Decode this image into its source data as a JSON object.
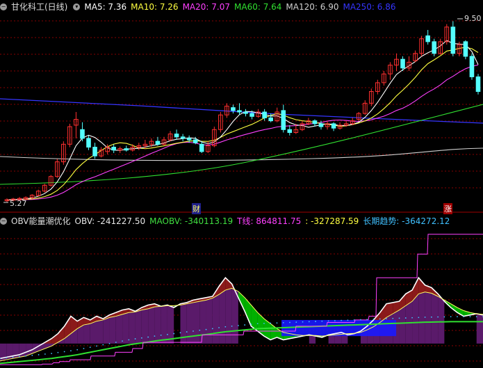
{
  "colors": {
    "bull": "#ff3030",
    "bear": "#54ffff",
    "ma5": "#ffffff",
    "ma10": "#ffff40",
    "ma20": "#ff40ff",
    "ma60": "#30e030",
    "ma120": "#d0d0d0",
    "ma250": "#3535ff",
    "grid": "#8a0000"
  },
  "header": {
    "icon": "circle-minus-icon",
    "title": "甘化科工(日线)",
    "ma": [
      {
        "label": "MA5: 7.36",
        "color": "#ffffff"
      },
      {
        "label": "MA10: 7.26",
        "color": "#ffff40"
      },
      {
        "label": "MA20: 7.07",
        "color": "#ff40ff"
      },
      {
        "label": "MA60: 7.64",
        "color": "#30e030"
      },
      {
        "label": "MA120: 6.90",
        "color": "#d0d0d0"
      },
      {
        "label": "MA250: 6.86",
        "color": "#3535ff"
      }
    ]
  },
  "price": {
    "high_label": "9.50",
    "low_label": "5.27",
    "marker_cai": "财",
    "marker_zhang": "涨",
    "candles": [
      [
        5.27,
        5.31,
        5.23,
        5.35
      ],
      [
        5.29,
        5.33,
        5.25,
        5.37
      ],
      [
        5.31,
        5.35,
        5.28,
        5.4
      ],
      [
        5.33,
        5.38,
        5.3,
        5.42
      ],
      [
        5.38,
        5.46,
        5.33,
        5.5
      ],
      [
        5.45,
        5.6,
        5.42,
        5.65
      ],
      [
        5.6,
        5.8,
        5.55,
        5.85
      ],
      [
        5.8,
        6.1,
        5.75,
        6.15
      ],
      [
        6.1,
        6.6,
        6.05,
        6.7
      ],
      [
        6.6,
        7.2,
        6.5,
        7.3
      ],
      [
        7.2,
        7.8,
        7.1,
        7.9
      ],
      [
        7.85,
        8.05,
        7.4,
        8.3
      ],
      [
        7.7,
        7.4,
        7.3,
        7.95
      ],
      [
        7.4,
        7.1,
        7.0,
        7.5
      ],
      [
        7.1,
        6.8,
        6.7,
        7.25
      ],
      [
        6.8,
        7.0,
        6.75,
        7.1
      ],
      [
        6.95,
        7.1,
        6.85,
        7.2
      ],
      [
        7.1,
        7.0,
        6.9,
        7.2
      ],
      [
        7.0,
        7.05,
        6.9,
        7.12
      ],
      [
        7.05,
        7.0,
        6.95,
        7.15
      ],
      [
        7.0,
        7.1,
        6.95,
        7.2
      ],
      [
        7.1,
        7.15,
        7.0,
        7.25
      ],
      [
        7.15,
        7.2,
        7.05,
        7.35
      ],
      [
        7.2,
        7.3,
        7.1,
        7.4
      ],
      [
        7.3,
        7.2,
        7.15,
        7.45
      ],
      [
        7.2,
        7.35,
        7.15,
        7.45
      ],
      [
        7.35,
        7.55,
        7.3,
        7.65
      ],
      [
        7.55,
        7.45,
        7.35,
        7.7
      ],
      [
        7.45,
        7.4,
        7.3,
        7.55
      ],
      [
        7.4,
        7.35,
        7.25,
        7.5
      ],
      [
        7.35,
        7.25,
        7.2,
        7.45
      ],
      [
        7.2,
        6.95,
        6.9,
        7.3
      ],
      [
        6.95,
        7.15,
        6.9,
        7.3
      ],
      [
        7.15,
        7.7,
        7.1,
        7.8
      ],
      [
        7.7,
        8.2,
        7.6,
        8.3
      ],
      [
        8.2,
        8.5,
        8.1,
        8.6
      ],
      [
        8.45,
        8.35,
        8.25,
        8.55
      ],
      [
        8.35,
        8.3,
        8.2,
        8.6
      ],
      [
        8.3,
        8.25,
        8.15,
        8.4
      ],
      [
        8.25,
        8.15,
        8.05,
        8.35
      ],
      [
        8.15,
        8.3,
        8.1,
        8.4
      ],
      [
        8.3,
        8.1,
        8.0,
        8.4
      ],
      [
        8.1,
        8.0,
        7.95,
        8.25
      ],
      [
        8.0,
        8.3,
        7.95,
        8.45
      ],
      [
        8.35,
        7.7,
        7.6,
        8.55
      ],
      [
        7.7,
        7.6,
        7.5,
        7.85
      ],
      [
        7.6,
        7.7,
        7.55,
        7.9
      ],
      [
        7.7,
        7.9,
        7.65,
        8.0
      ],
      [
        7.9,
        8.0,
        7.85,
        8.1
      ],
      [
        8.0,
        7.9,
        7.8,
        8.05
      ],
      [
        7.9,
        7.8,
        7.7,
        8.0
      ],
      [
        7.8,
        7.9,
        7.7,
        8.0
      ],
      [
        7.9,
        7.75,
        7.65,
        7.95
      ],
      [
        7.75,
        7.85,
        7.7,
        7.95
      ],
      [
        7.85,
        7.9,
        7.8,
        8.0
      ],
      [
        7.9,
        8.0,
        7.85,
        8.1
      ],
      [
        8.05,
        8.25,
        8.0,
        8.3
      ],
      [
        8.25,
        8.6,
        8.2,
        8.7
      ],
      [
        8.6,
        9.0,
        8.5,
        9.1
      ],
      [
        9.0,
        9.3,
        8.9,
        9.4
      ],
      [
        9.3,
        9.6,
        9.2,
        9.7
      ],
      [
        9.6,
        9.9,
        9.4,
        10.0
      ],
      [
        9.9,
        10.1,
        9.7,
        10.3
      ],
      [
        10.1,
        9.8,
        9.7,
        10.2
      ],
      [
        9.8,
        10.0,
        9.7,
        10.2
      ],
      [
        10.05,
        10.3,
        10.0,
        10.4
      ],
      [
        10.3,
        10.8,
        10.2,
        10.9
      ],
      [
        10.9,
        10.7,
        10.6,
        11.1
      ],
      [
        10.7,
        10.3,
        10.2,
        10.8
      ],
      [
        10.3,
        10.7,
        10.25,
        10.8
      ],
      [
        10.7,
        11.2,
        10.6,
        11.3
      ],
      [
        11.2,
        10.3,
        10.2,
        11.4
      ],
      [
        10.3,
        10.6,
        10.2,
        10.7
      ],
      [
        10.7,
        10.2,
        10.1,
        10.75
      ],
      [
        10.2,
        9.5,
        9.4,
        10.3
      ],
      [
        9.5,
        9.0,
        8.9,
        9.6
      ]
    ]
  },
  "indicator": {
    "icon": "circle-minus-icon",
    "name": "OBV能量潮优化",
    "items": [
      {
        "label": "OBV: -241227.50",
        "color": "#e8e8e8"
      },
      {
        "label": "MAOBV: -340113.19",
        "color": "#40e040"
      },
      {
        "label": "T线: 864811.75",
        "color": "#ff40ff"
      },
      {
        "label": ": -327287.59",
        "color": "#ffff40"
      },
      {
        "label": "长期趋势: -364272.12",
        "color": "#40c0ff"
      }
    ],
    "obv": [
      -640,
      -630,
      -620,
      -610,
      -590,
      -570,
      -540,
      -510,
      -480,
      -440,
      -380,
      -300,
      -340,
      -310,
      -330,
      -300,
      -320,
      -290,
      -270,
      -250,
      -240,
      -260,
      -230,
      -210,
      -200,
      -220,
      -210,
      -230,
      -200,
      -190,
      -170,
      -160,
      -150,
      -140,
      -60,
      10,
      -40,
      -150,
      -260,
      -380,
      -420,
      -460,
      -490,
      -470,
      -490,
      -480,
      -470,
      -460,
      -450,
      -460,
      -470,
      -450,
      -440,
      -430,
      -450,
      -440,
      -420,
      -380,
      -330,
      -270,
      -200,
      -190,
      -180,
      -120,
      -90,
      10,
      -50,
      -70,
      -120,
      -180,
      -230,
      -270,
      -300,
      -290,
      -280,
      -290
    ],
    "maobv": [
      -660,
      -650,
      -640,
      -630,
      -620,
      -600,
      -580,
      -560,
      -540,
      -510,
      -480,
      -440,
      -400,
      -370,
      -360,
      -340,
      -330,
      -310,
      -300,
      -285,
      -270,
      -265,
      -250,
      -240,
      -225,
      -220,
      -215,
      -215,
      -210,
      -200,
      -190,
      -180,
      -170,
      -155,
      -125,
      -90,
      -75,
      -100,
      -150,
      -210,
      -270,
      -320,
      -360,
      -400,
      -430,
      -440,
      -450,
      -455,
      -455,
      -455,
      -460,
      -455,
      -450,
      -445,
      -440,
      -438,
      -430,
      -410,
      -385,
      -350,
      -310,
      -280,
      -250,
      -215,
      -180,
      -120,
      -105,
      -115,
      -140,
      -170,
      -200,
      -230,
      -255,
      -270,
      -280,
      -285
    ],
    "long_trend": [
      -680,
      -675,
      -670,
      -665,
      -660,
      -655,
      -650,
      -645,
      -640,
      -632,
      -625,
      -618,
      -610,
      -600,
      -590,
      -580,
      -570,
      -560,
      -550,
      -540,
      -530,
      -522,
      -515,
      -508,
      -500,
      -493,
      -487,
      -480,
      -473,
      -466,
      -460,
      -453,
      -447,
      -440,
      -432,
      -425,
      -420,
      -415,
      -410,
      -405,
      -400,
      -398,
      -396,
      -394,
      -392,
      -390,
      -388,
      -386,
      -384,
      -382,
      -380,
      -378,
      -376,
      -374,
      -372,
      -370,
      -368,
      -366,
      -364,
      -362,
      -360,
      -358,
      -356,
      -354,
      -352,
      -350,
      -348,
      -347,
      -346,
      -345,
      -344,
      -344,
      -344,
      -344,
      -344,
      -344
    ],
    "tline_x": [
      0,
      60,
      61,
      75,
      77,
      85,
      86,
      100,
      101,
      130,
      131,
      165,
      166,
      190,
      191,
      205,
      206,
      290,
      291,
      350,
      351,
      425,
      426,
      470,
      471,
      510,
      511,
      530,
      531,
      541,
      542,
      600,
      601,
      615,
      616,
      695
    ],
    "tline_y": [
      -690,
      -690,
      -685,
      -685,
      -675,
      -675,
      -665,
      -665,
      -650,
      -650,
      -620,
      -620,
      -590,
      -590,
      -560,
      -560,
      -510,
      -510,
      -450,
      -450,
      -420,
      -420,
      -380,
      -380,
      -350,
      -350,
      -330,
      -330,
      -300,
      -300,
      10,
      10,
      200,
      200,
      360,
      360
    ]
  }
}
